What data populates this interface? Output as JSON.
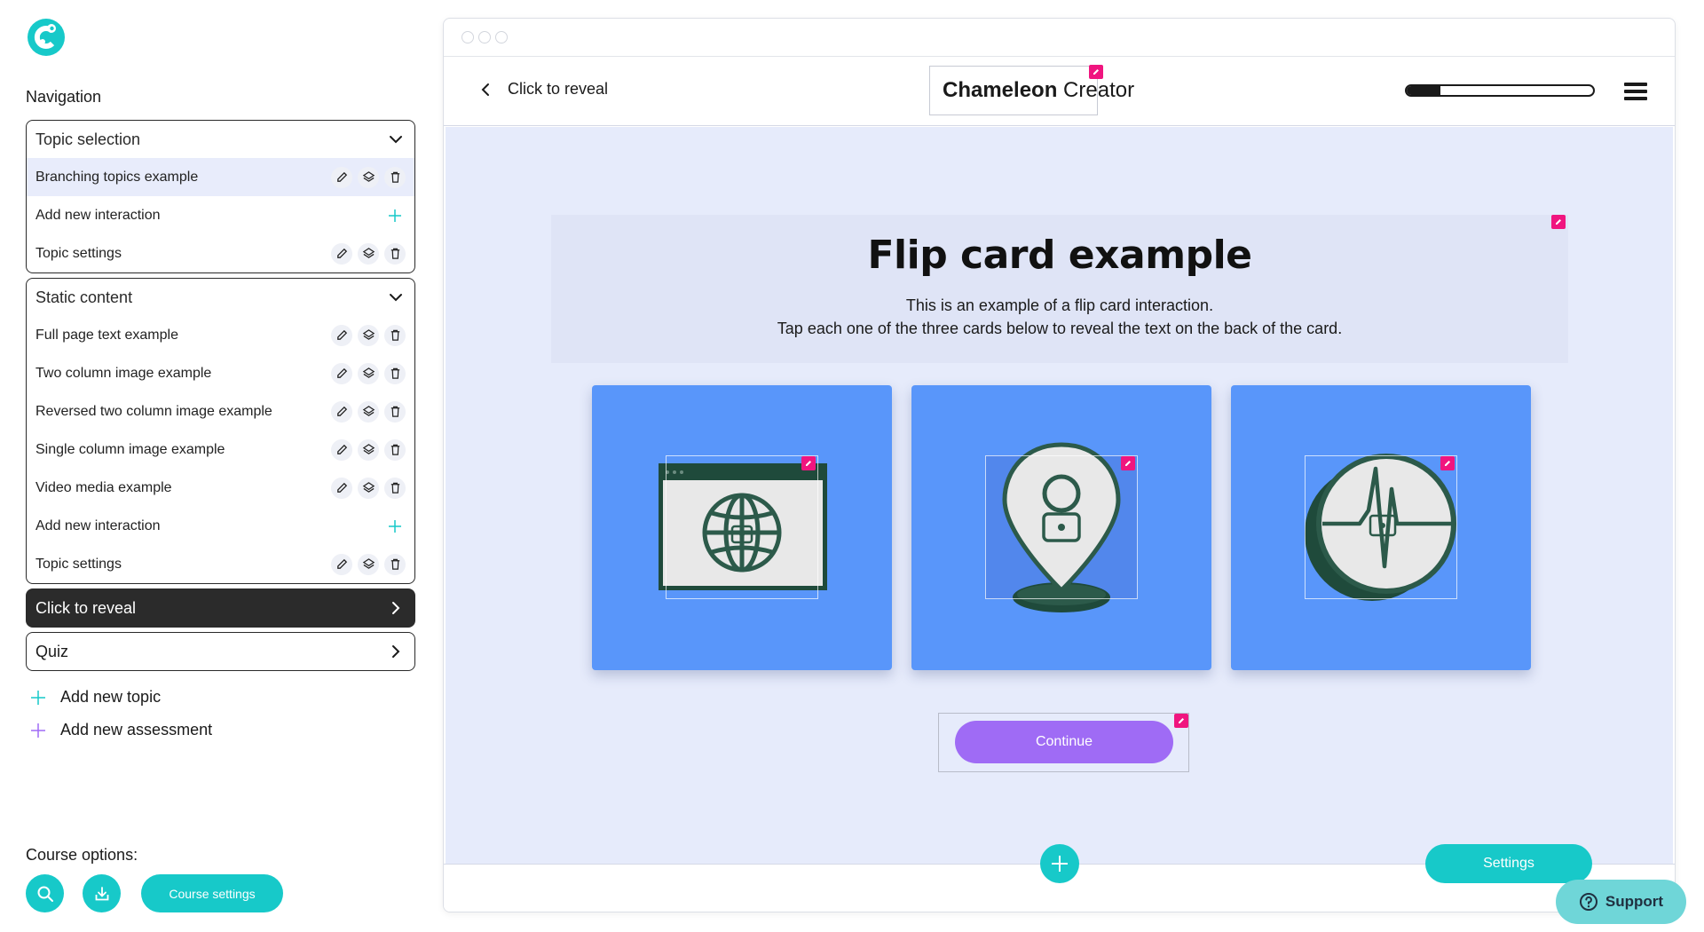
{
  "sidebar": {
    "nav_heading": "Navigation",
    "groups": [
      {
        "title": "Topic selection",
        "items": [
          {
            "label": "Branching topics example"
          },
          {
            "label": "Add new interaction"
          },
          {
            "label": "Topic settings"
          }
        ]
      },
      {
        "title": "Static content",
        "items": [
          {
            "label": "Full page text example"
          },
          {
            "label": "Two column image example"
          },
          {
            "label": "Reversed two column image example"
          },
          {
            "label": "Single column image example"
          },
          {
            "label": "Video media example"
          },
          {
            "label": "Add new interaction"
          },
          {
            "label": "Topic settings"
          }
        ]
      }
    ],
    "topics": [
      {
        "label": "Click to reveal"
      },
      {
        "label": "Quiz"
      }
    ],
    "add_topic": "Add new topic",
    "add_assessment": "Add new assessment",
    "course_options_label": "Course options:",
    "course_settings_label": "Course settings"
  },
  "preview": {
    "back_label": "Click to reveal",
    "brand": {
      "bold": "Chameleon",
      "light": " Creator"
    },
    "progress_fraction": 0.18,
    "title": "Flip card example",
    "description_line1": "This is an example of a flip card interaction.",
    "description_line2": "Tap each one of the three cards below to reveal the text on the back of the card.",
    "cards": [
      {
        "icon": "globe-browser-icon"
      },
      {
        "icon": "location-pin-icon"
      },
      {
        "icon": "heartbeat-icon"
      }
    ],
    "continue_label": "Continue",
    "settings_label": "Settings"
  },
  "support_label": "Support",
  "colors": {
    "accent_teal": "#17c9c9",
    "edit_pink": "#f0157f",
    "card_blue": "#5996fa",
    "continue_purple": "#9f6bf5",
    "canvas_bg": "#e6ebfb",
    "active_topic": "#2b2b2b"
  }
}
